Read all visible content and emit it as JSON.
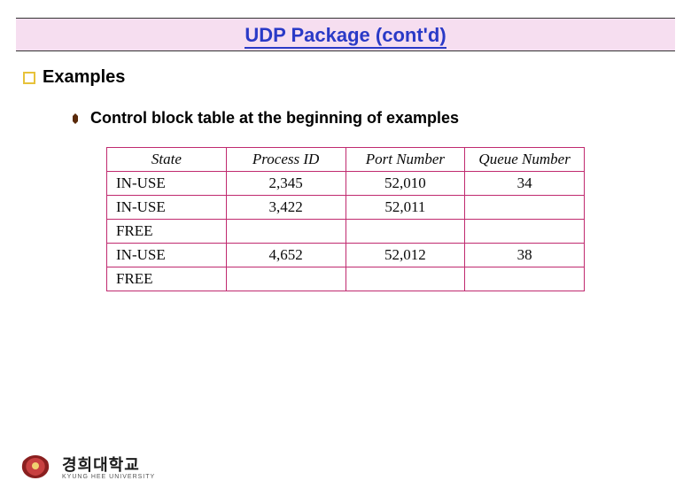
{
  "title": "UDP Package (cont'd)",
  "bullets": {
    "main": "Examples",
    "sub": "Control block table at the beginning of examples"
  },
  "table": {
    "headers": [
      "State",
      "Process ID",
      "Port Number",
      "Queue Number"
    ],
    "rows": [
      {
        "state": "IN-USE",
        "pid": "2,345",
        "port": "52,010",
        "queue": "34"
      },
      {
        "state": "IN-USE",
        "pid": "3,422",
        "port": "52,011",
        "queue": ""
      },
      {
        "state": "FREE",
        "pid": "",
        "port": "",
        "queue": ""
      },
      {
        "state": "IN-USE",
        "pid": "4,652",
        "port": "52,012",
        "queue": "38"
      },
      {
        "state": "FREE",
        "pid": "",
        "port": "",
        "queue": ""
      }
    ]
  },
  "logo": {
    "name_kr": "경희대학교",
    "name_en": "KYUNG HEE UNIVERSITY"
  },
  "chart_data": {
    "type": "table",
    "title": "Control block table at the beginning of examples",
    "columns": [
      "State",
      "Process ID",
      "Port Number",
      "Queue Number"
    ],
    "rows": [
      [
        "IN-USE",
        2345,
        52010,
        34
      ],
      [
        "IN-USE",
        3422,
        52011,
        null
      ],
      [
        "FREE",
        null,
        null,
        null
      ],
      [
        "IN-USE",
        4652,
        52012,
        38
      ],
      [
        "FREE",
        null,
        null,
        null
      ]
    ]
  }
}
